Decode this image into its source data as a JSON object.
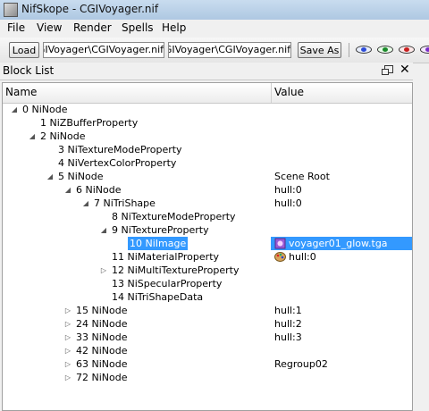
{
  "window": {
    "title": "NifSkope - CGIVoyager.nif",
    "icon": "nifskope-app-icon"
  },
  "menu": [
    "File",
    "View",
    "Render",
    "Spells",
    "Help"
  ],
  "toolbar": {
    "load_label": "Load",
    "load_path": "CGIVoyager\\CGIVoyager.nif",
    "save_path": "CGIVoyager\\CGIVoyager.nif",
    "save_label": "Save As",
    "icons": [
      "eye-blue-icon",
      "eye-green-icon",
      "eye-red-icon",
      "eye-purple-icon"
    ]
  },
  "dock": {
    "title": "Block List",
    "float_icon": "float-icon",
    "close_icon": "close-icon"
  },
  "columns": {
    "name": "Name",
    "value": "Value"
  },
  "tree": [
    {
      "name": "0 NiNode",
      "value": "",
      "arrow": "expanded"
    },
    {
      "name": "1 NiZBufferProperty",
      "value": "",
      "arrow": ""
    },
    {
      "name": "2 NiNode",
      "value": "",
      "arrow": "expanded"
    },
    {
      "name": "3 NiTextureModeProperty",
      "value": "",
      "arrow": ""
    },
    {
      "name": "4 NiVertexColorProperty",
      "value": "",
      "arrow": ""
    },
    {
      "name": "5 NiNode",
      "value": "Scene Root",
      "arrow": "expanded"
    },
    {
      "name": "6 NiNode",
      "value": "hull:0",
      "arrow": "expanded"
    },
    {
      "name": "7 NiTriShape",
      "value": "hull:0",
      "arrow": "expanded"
    },
    {
      "name": "8 NiTextureModeProperty",
      "value": "",
      "arrow": ""
    },
    {
      "name": "9 NiTextureProperty",
      "value": "",
      "arrow": "expanded"
    },
    {
      "name": "10 NiImage",
      "value": "voyager01_glow.tga",
      "arrow": "",
      "icon": "texture-icon",
      "selected": true
    },
    {
      "name": "11 NiMaterialProperty",
      "value": "hull:0",
      "arrow": "",
      "icon": "palette-icon"
    },
    {
      "name": "12 NiMultiTextureProperty",
      "value": "",
      "arrow": "collapsed"
    },
    {
      "name": "13 NiSpecularProperty",
      "value": "",
      "arrow": ""
    },
    {
      "name": "14 NiTriShapeData",
      "value": "",
      "arrow": ""
    },
    {
      "name": "15 NiNode",
      "value": "hull:1",
      "arrow": "collapsed"
    },
    {
      "name": "24 NiNode",
      "value": "hull:2",
      "arrow": "collapsed"
    },
    {
      "name": "33 NiNode",
      "value": "hull:3",
      "arrow": "collapsed"
    },
    {
      "name": "42 NiNode",
      "value": "",
      "arrow": "collapsed"
    },
    {
      "name": "63 NiNode",
      "value": "Regroup02",
      "arrow": "collapsed"
    },
    {
      "name": "72 NiNode",
      "value": "",
      "arrow": "collapsed"
    }
  ],
  "colors": {
    "selection": "#3399ff",
    "titlebar": "#b9d1ea"
  }
}
